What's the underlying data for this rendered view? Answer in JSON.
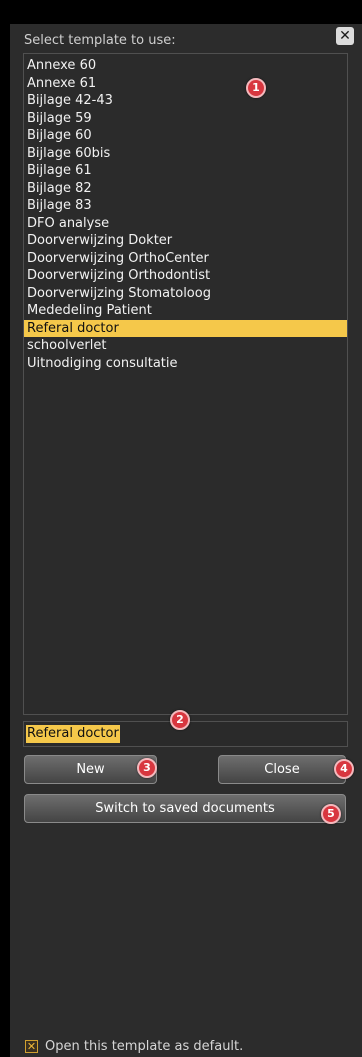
{
  "dialog": {
    "header_label": "Select template to use:",
    "close_glyph": "✕"
  },
  "templates": {
    "items": [
      "Annexe 60",
      "Annexe 61",
      "Bijlage 42-43",
      "Bijlage 59",
      "Bijlage 60",
      "Bijlage 60bis",
      "Bijlage 61",
      "Bijlage 82",
      "Bijlage 83",
      "DFO analyse",
      "Doorverwijzing Dokter",
      "Doorverwijzing OrthoCenter",
      "Doorverwijzing Orthodontist",
      "Doorverwijzing Stomatoloog",
      "Mededeling Patient",
      "Referal doctor",
      "schoolverlet",
      "Uitnodiging consultatie"
    ],
    "selected_index": 15
  },
  "name_field": {
    "value": "Referal doctor"
  },
  "buttons": {
    "new_label": "New",
    "close_label": "Close",
    "switch_label": "Switch to saved documents"
  },
  "default_option": {
    "checked": true,
    "check_glyph": "✕",
    "label": "Open this template as default."
  },
  "badges": [
    "1",
    "2",
    "3",
    "4",
    "5"
  ],
  "colors": {
    "selection": "#f5c84a",
    "badge": "#d8363f",
    "panel": "#2c2c2c"
  }
}
